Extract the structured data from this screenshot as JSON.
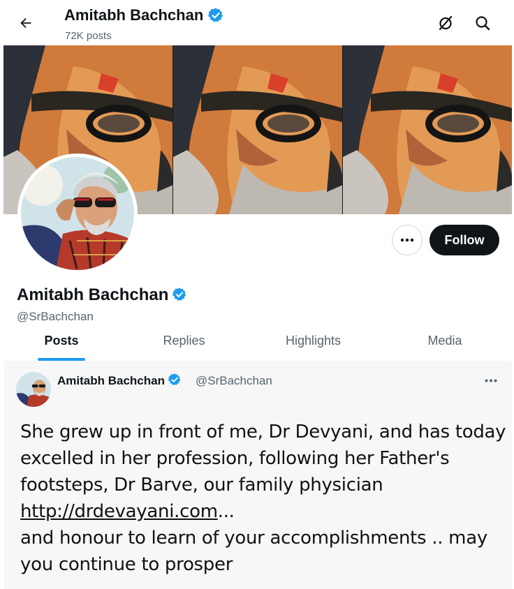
{
  "header": {
    "title": "Amitabh Bachchan",
    "posts_count": "72K posts",
    "back_icon": "arrow-left-icon",
    "icons": [
      "grok-icon",
      "search-icon"
    ]
  },
  "profile": {
    "name": "Amitabh Bachchan",
    "handle": "@SrBachchan",
    "verified": true,
    "follow_label": "Follow",
    "more_icon": "more-horizontal-icon"
  },
  "tabs": [
    {
      "label": "Posts",
      "active": true
    },
    {
      "label": "Replies",
      "active": false
    },
    {
      "label": "Highlights",
      "active": false
    },
    {
      "label": "Media",
      "active": false
    }
  ],
  "post": {
    "author_name": "Amitabh Bachchan",
    "author_handle": "@SrBachchan",
    "text_part1": "She grew up in front of me, Dr Devyani, and has today excelled in her profession, following her Father's footsteps, Dr Barve, our family physician",
    "link": "http://drdevayani.com",
    "link_suffix": "...",
    "text_part2": "and honour to learn of your accomplishments .. may you continue to prosper"
  },
  "colors": {
    "accent": "#1d9bf0",
    "text": "#0f1419",
    "secondary": "#536471",
    "follow_bg": "#0f1419",
    "post_bg": "#f7f7f7"
  }
}
